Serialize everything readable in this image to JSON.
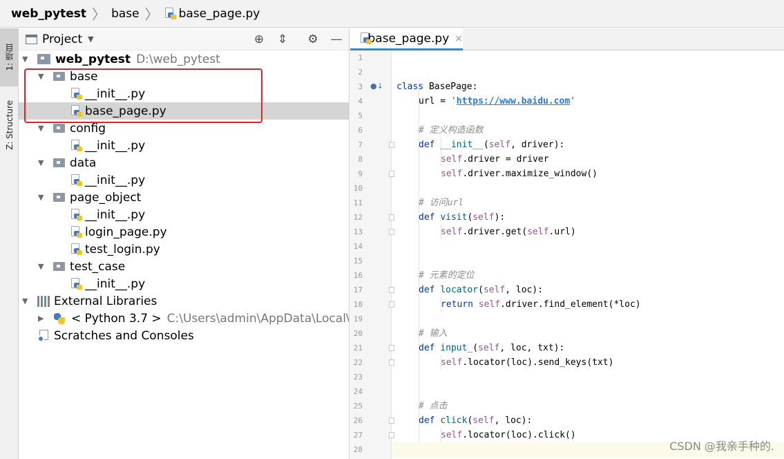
{
  "breadcrumb": {
    "project": "web_pytest",
    "folder": "base",
    "file": "base_page.py"
  },
  "sidebar": {
    "project_tab": "1: 项目",
    "structure_tab": "Z: Structure"
  },
  "project_panel": {
    "title": "Project"
  },
  "tree": {
    "root_name": "web_pytest",
    "root_path": "D:\\web_pytest",
    "base": "base",
    "base_init": "__init__.py",
    "base_page": "base_page.py",
    "config": "config",
    "config_init": "__init__.py",
    "data": "data",
    "data_init": "__init__.py",
    "page_object": "page_object",
    "po_init": "__init__.py",
    "login_page": "login_page.py",
    "test_login": "test_login.py",
    "test_case": "test_case",
    "tc_init": "__init__.py",
    "ext_libs": "External Libraries",
    "python": "< Python 3.7 >",
    "python_path": "C:\\Users\\admin\\AppData\\Local\\Prog",
    "scratches": "Scratches and Consoles"
  },
  "editor": {
    "tab_label": "base_page.py",
    "close": "×"
  },
  "code": {
    "l3_kw": "class",
    "l3_name": " BasePage:",
    "l4_a": "url = ",
    "l4_q1": "'",
    "l4_url": "https://www.baidu.com",
    "l4_q2": "'",
    "l6": "# 定义构造函数",
    "l7_kw": "def ",
    "l7_fn": "__init__",
    "l7_a": "(",
    "l7_self": "self",
    "l7_b": ", driver):",
    "l8_self": "self",
    "l8_b": ".driver = driver",
    "l9_self": "self",
    "l9_b": ".driver.maximize_window()",
    "l11": "# 访问url",
    "l12_kw": "def ",
    "l12_fn": "visit",
    "l12_a": "(",
    "l12_self": "self",
    "l12_b": "):",
    "l13_self": "self",
    "l13_a": ".driver.get(",
    "l13_self2": "self",
    "l13_b": ".url)",
    "l16": "# 元素的定位",
    "l17_kw": "def ",
    "l17_fn": "locator",
    "l17_a": "(",
    "l17_self": "self",
    "l17_b": ", loc):",
    "l18_kw": "return ",
    "l18_self": "self",
    "l18_b": ".driver.find_element(*loc)",
    "l20": "# 输入",
    "l21_kw": "def ",
    "l21_fn": "input_",
    "l21_a": "(",
    "l21_self": "self",
    "l21_b": ", loc, txt):",
    "l22_self": "self",
    "l22_b": ".locator(loc).send_keys(txt)",
    "l25": "# 点击",
    "l26_kw": "def ",
    "l26_fn": "click",
    "l26_a": "(",
    "l26_self": "self",
    "l26_b": ", loc):",
    "l27_self": "self",
    "l27_b": ".locator(loc).click()"
  },
  "line_numbers": [
    "1",
    "2",
    "3",
    "4",
    "5",
    "6",
    "7",
    "8",
    "9",
    "10",
    "11",
    "12",
    "13",
    "14",
    "15",
    "16",
    "17",
    "18",
    "19",
    "20",
    "21",
    "22",
    "23",
    "24",
    "25",
    "26",
    "27",
    "28"
  ],
  "watermark": "CSDN @我亲手种的."
}
